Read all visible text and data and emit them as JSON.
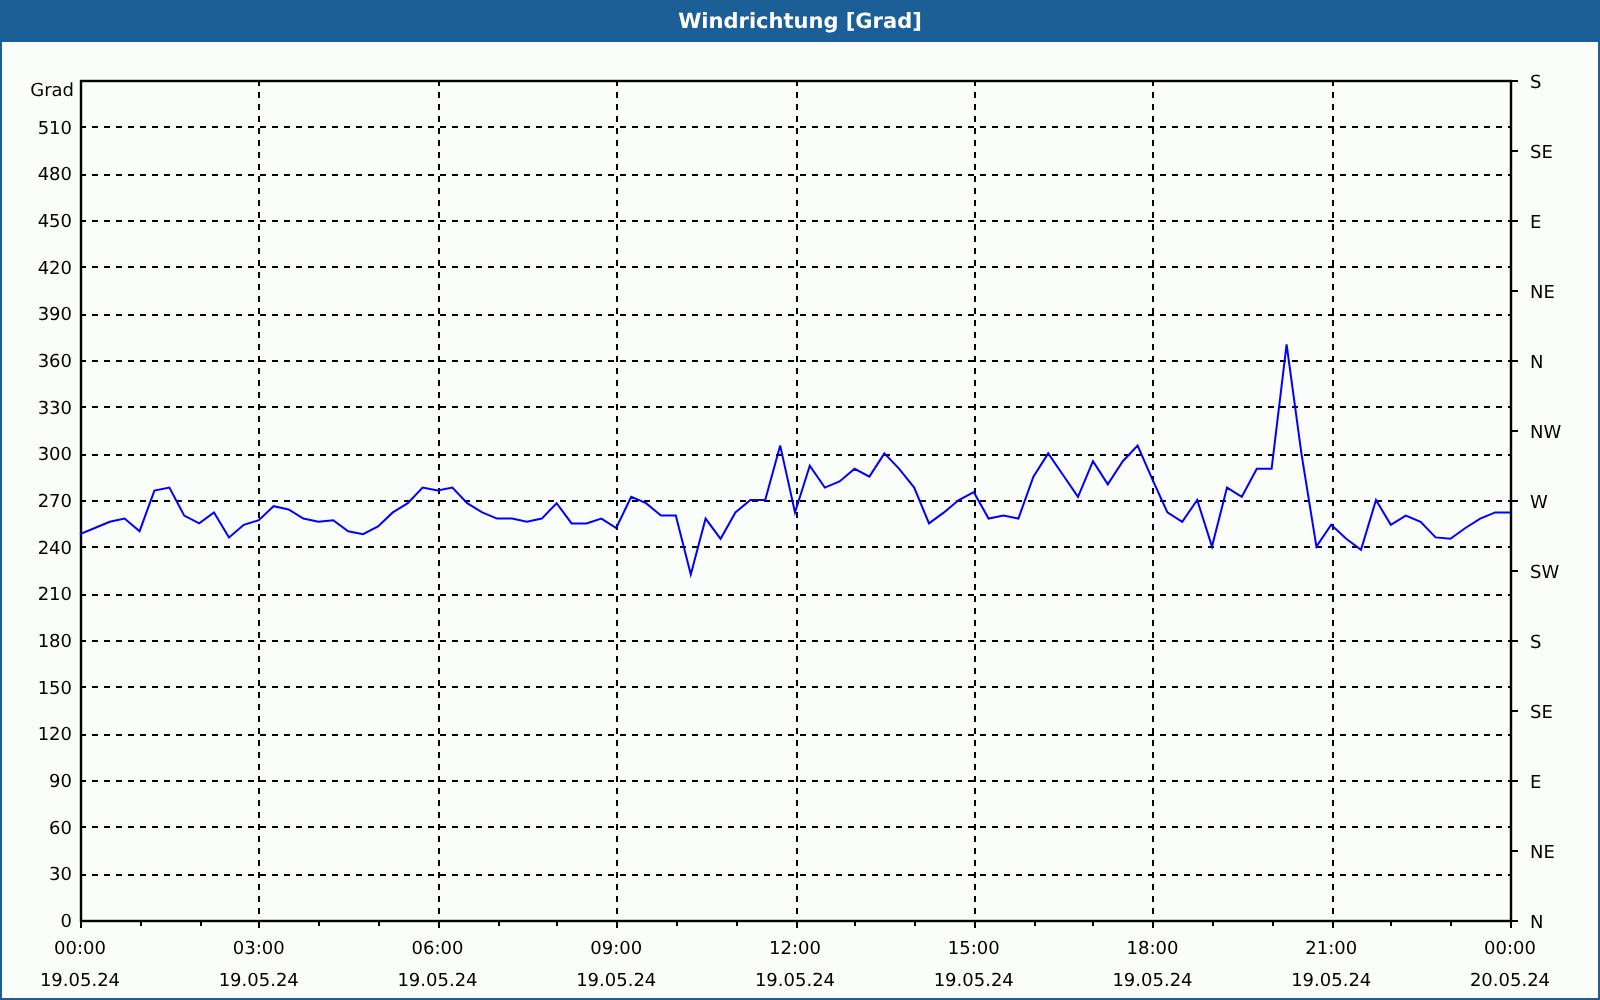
{
  "window": {
    "title": "Windrichtung [Grad]"
  },
  "chart_data": {
    "type": "line",
    "ylabel": "Grad",
    "xlim": [
      0,
      24
    ],
    "ylim": [
      0,
      540
    ],
    "grid": true,
    "yticks": [
      0,
      30,
      60,
      90,
      120,
      150,
      180,
      210,
      240,
      270,
      300,
      330,
      360,
      390,
      420,
      450,
      480,
      510
    ],
    "xticks": [
      {
        "value": 0,
        "label": "00:00"
      },
      {
        "value": 3,
        "label": "03:00"
      },
      {
        "value": 6,
        "label": "06:00"
      },
      {
        "value": 9,
        "label": "09:00"
      },
      {
        "value": 12,
        "label": "12:00"
      },
      {
        "value": 15,
        "label": "15:00"
      },
      {
        "value": 18,
        "label": "18:00"
      },
      {
        "value": 21,
        "label": "21:00"
      },
      {
        "value": 24,
        "label": "00:00"
      }
    ],
    "x": [
      0,
      0.25,
      0.5,
      0.75,
      1,
      1.25,
      1.5,
      1.75,
      2,
      2.25,
      2.5,
      2.75,
      3,
      3.25,
      3.5,
      3.75,
      4,
      4.25,
      4.5,
      4.75,
      5,
      5.25,
      5.5,
      5.75,
      6,
      6.25,
      6.5,
      6.75,
      7,
      7.25,
      7.5,
      7.75,
      8,
      8.25,
      8.5,
      8.75,
      9,
      9.25,
      9.5,
      9.75,
      10,
      10.25,
      10.5,
      10.75,
      11,
      11.25,
      11.5,
      11.75,
      12,
      12.25,
      12.5,
      12.75,
      13,
      13.25,
      13.5,
      13.75,
      14,
      14.25,
      14.5,
      14.75,
      15,
      15.25,
      15.5,
      15.75,
      16,
      16.25,
      16.5,
      16.75,
      17,
      17.25,
      17.5,
      17.75,
      18,
      18.25,
      18.5,
      18.75,
      19,
      19.25,
      19.5,
      19.75,
      20,
      20.25,
      20.5,
      20.75,
      21,
      21.25,
      21.5,
      21.75,
      22,
      22.25,
      22.5,
      22.75,
      23,
      23.25,
      23.5,
      23.75,
      24
    ],
    "series": [
      {
        "color": "#0000ff",
        "values": [
          248,
          252,
          256,
          258,
          250,
          276,
          278,
          260,
          255,
          262,
          246,
          254,
          257,
          266,
          264,
          258,
          256,
          257,
          250,
          248,
          253,
          262,
          268,
          278,
          276,
          278,
          268,
          262,
          258,
          258,
          256,
          258,
          268,
          255,
          255,
          258,
          252,
          272,
          268,
          260,
          260,
          222,
          258,
          245,
          262,
          270,
          270,
          305,
          262,
          292,
          278,
          282,
          290,
          285,
          300,
          290,
          278,
          255,
          262,
          270,
          275,
          258,
          260,
          258,
          285,
          300,
          286,
          272,
          295,
          280,
          295,
          305,
          283,
          262,
          256,
          270,
          240,
          278,
          272,
          290,
          290,
          370,
          300,
          240,
          254,
          245,
          238,
          270,
          254,
          260,
          256,
          246,
          245,
          252,
          258,
          262,
          262
        ]
      }
    ]
  },
  "x_axis_dates": [
    "19.05.24",
    "19.05.24",
    "19.05.24",
    "19.05.24",
    "19.05.24",
    "19.05.24",
    "19.05.24",
    "19.05.24",
    "20.05.24"
  ],
  "right_axis_labels": [
    "S",
    "SE",
    "E",
    "NE",
    "N",
    "NW",
    "W",
    "SW",
    "S",
    "SE",
    "E",
    "NE",
    "N"
  ]
}
